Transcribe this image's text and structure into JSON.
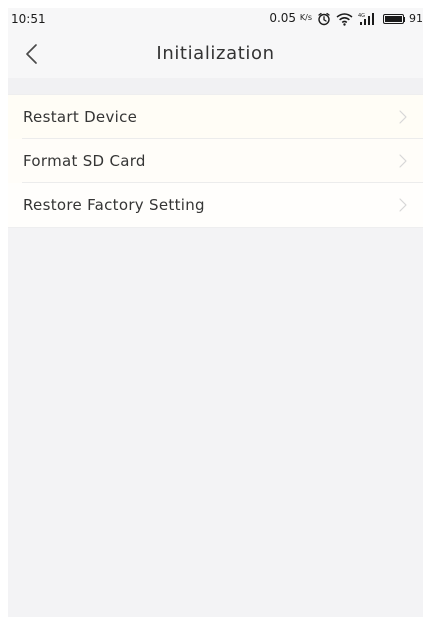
{
  "status_bar": {
    "time": "10:51",
    "network_speed": "0.05",
    "network_speed_unit": "K/s",
    "battery": "91",
    "icons": [
      "alarm-icon",
      "wifi-icon",
      "signal-icon",
      "battery-icon"
    ]
  },
  "header": {
    "title": "Initialization",
    "back_icon": "back-chevron-icon"
  },
  "menu": {
    "items": [
      {
        "label": "Restart Device",
        "icon": "chevron-right-icon"
      },
      {
        "label": "Format SD Card",
        "icon": "chevron-right-icon"
      },
      {
        "label": "Restore Factory Setting",
        "icon": "chevron-right-icon"
      }
    ]
  },
  "colors": {
    "background": "#f3f3f5",
    "header_background": "#f7f7f8",
    "item_background": "#fffdf8",
    "text": "#353535",
    "divider": "#ececec",
    "chevron": "#d7d7d7"
  }
}
